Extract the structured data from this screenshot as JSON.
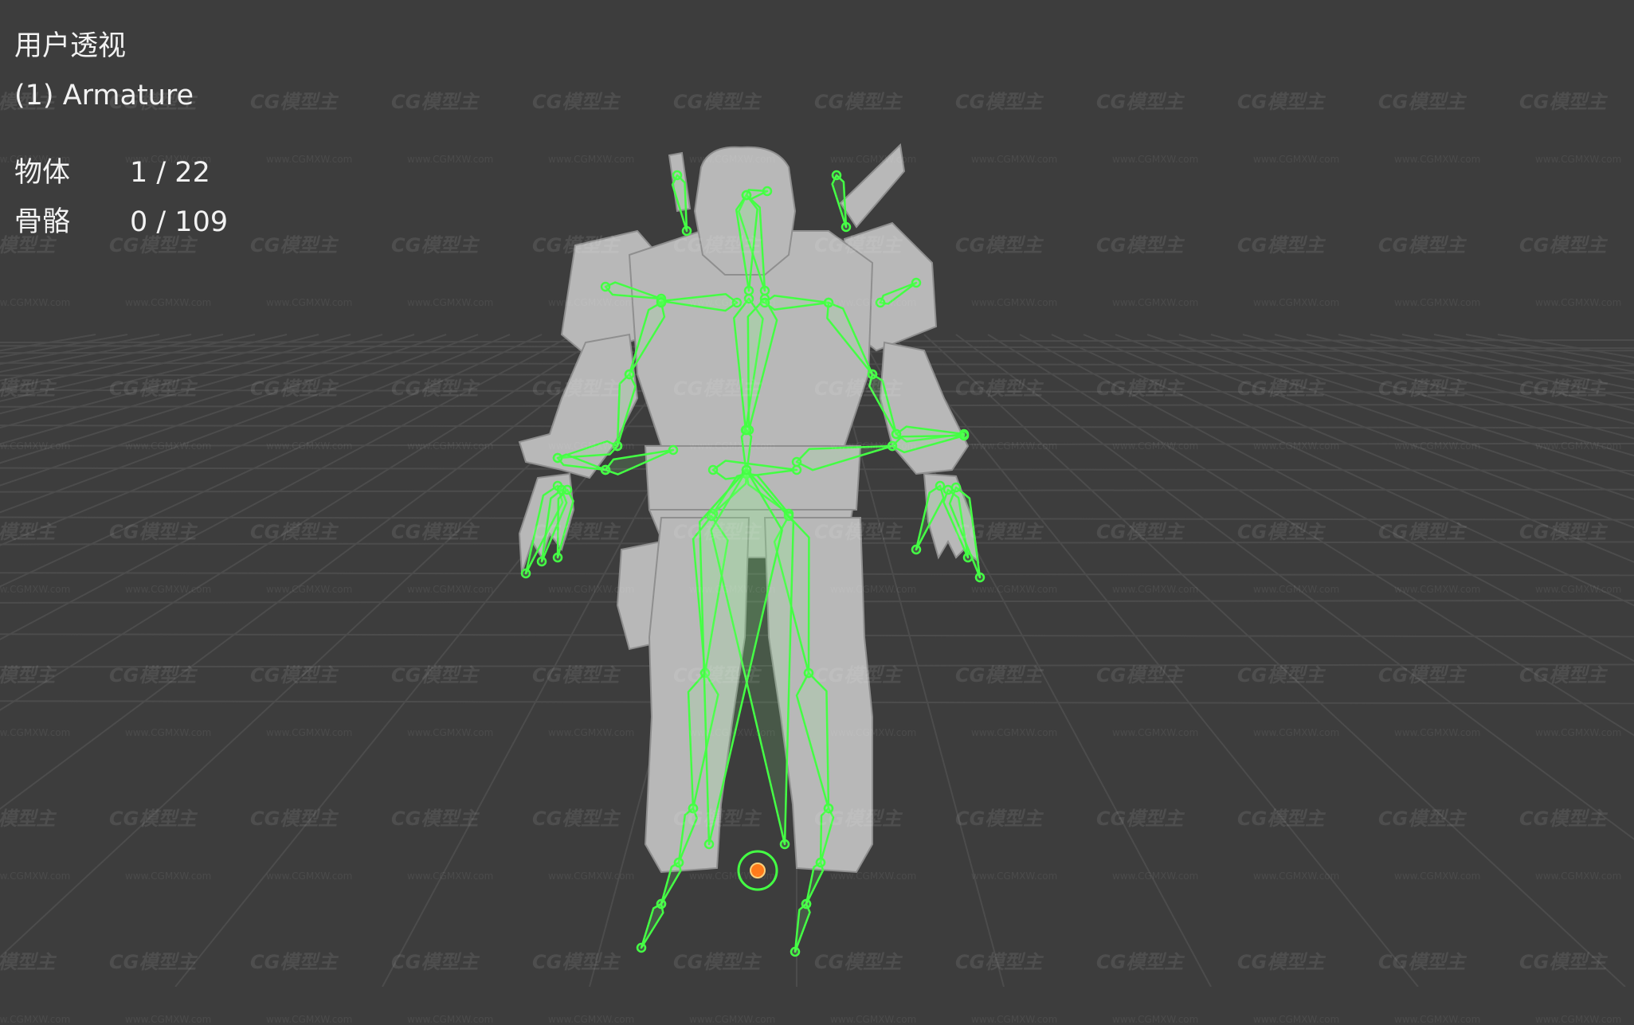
{
  "viewport": {
    "view_name": "用户透视",
    "active_object": "(1) Armature",
    "stats": [
      {
        "label": "物体",
        "value": "1 / 22"
      },
      {
        "label": "骨骼",
        "value": "0 / 109"
      }
    ]
  },
  "watermark": {
    "logo_text": "CG模型主",
    "url_text": "www.CGMXW.com"
  },
  "colors": {
    "background": "#3d3d3d",
    "grid": "#4a4a4a",
    "bone": "#44ff44",
    "mesh": "#b9b9b9",
    "origin": "#ff7a1a",
    "header_tab": "#d9a441"
  },
  "icons": {
    "model": "armored-soldier-mesh",
    "rig": "armature-bones",
    "origin": "origin-dot"
  }
}
